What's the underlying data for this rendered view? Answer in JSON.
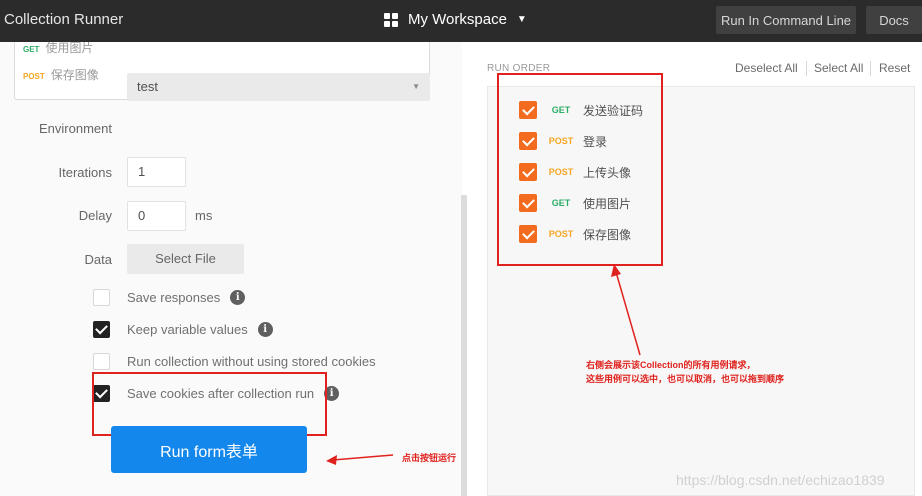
{
  "header": {
    "app_title": "Collection Runner",
    "workspace": "My Workspace",
    "run_cli": "Run In Command Line",
    "docs": "Docs"
  },
  "requests_preview": [
    {
      "method": "GET",
      "name": "使用图片"
    },
    {
      "method": "POST",
      "name": "保存图像"
    }
  ],
  "form": {
    "environment_label": "Environment",
    "environment_value": "test",
    "iterations_label": "Iterations",
    "iterations_value": "1",
    "delay_label": "Delay",
    "delay_value": "0",
    "delay_unit": "ms",
    "data_label": "Data",
    "select_file": "Select File"
  },
  "options": [
    {
      "label": "Save responses",
      "checked": false,
      "info": true
    },
    {
      "label": "Keep variable values",
      "checked": true,
      "info": true
    },
    {
      "label": "Run collection without using stored cookies",
      "checked": false,
      "info": false
    },
    {
      "label": "Save cookies after collection run",
      "checked": true,
      "info": true
    }
  ],
  "run_button": "Run form表单",
  "run_annotation": "点击按钮运行",
  "run_order": {
    "label": "RUN ORDER",
    "deselect_all": "Deselect All",
    "select_all": "Select All",
    "reset": "Reset",
    "items": [
      {
        "method": "GET",
        "name": "发送验证码",
        "checked": true
      },
      {
        "method": "POST",
        "name": "登录",
        "checked": true
      },
      {
        "method": "POST",
        "name": "上传头像",
        "checked": true
      },
      {
        "method": "GET",
        "name": "使用图片",
        "checked": true
      },
      {
        "method": "POST",
        "name": "保存图像",
        "checked": true
      }
    ]
  },
  "annotation_right": {
    "line1": "右侧会展示该Collection的所有用例请求，",
    "line2": "这些用例可以选中，也可以取消，也可以拖到顺序"
  },
  "watermark": "https://blog.csdn.net/echizao1839",
  "colors": {
    "accent": "#1387ec",
    "checkbox_orange": "#f26b1e",
    "annotation_red": "#e0221e",
    "get": "#2cae67",
    "post": "#f6a623"
  }
}
